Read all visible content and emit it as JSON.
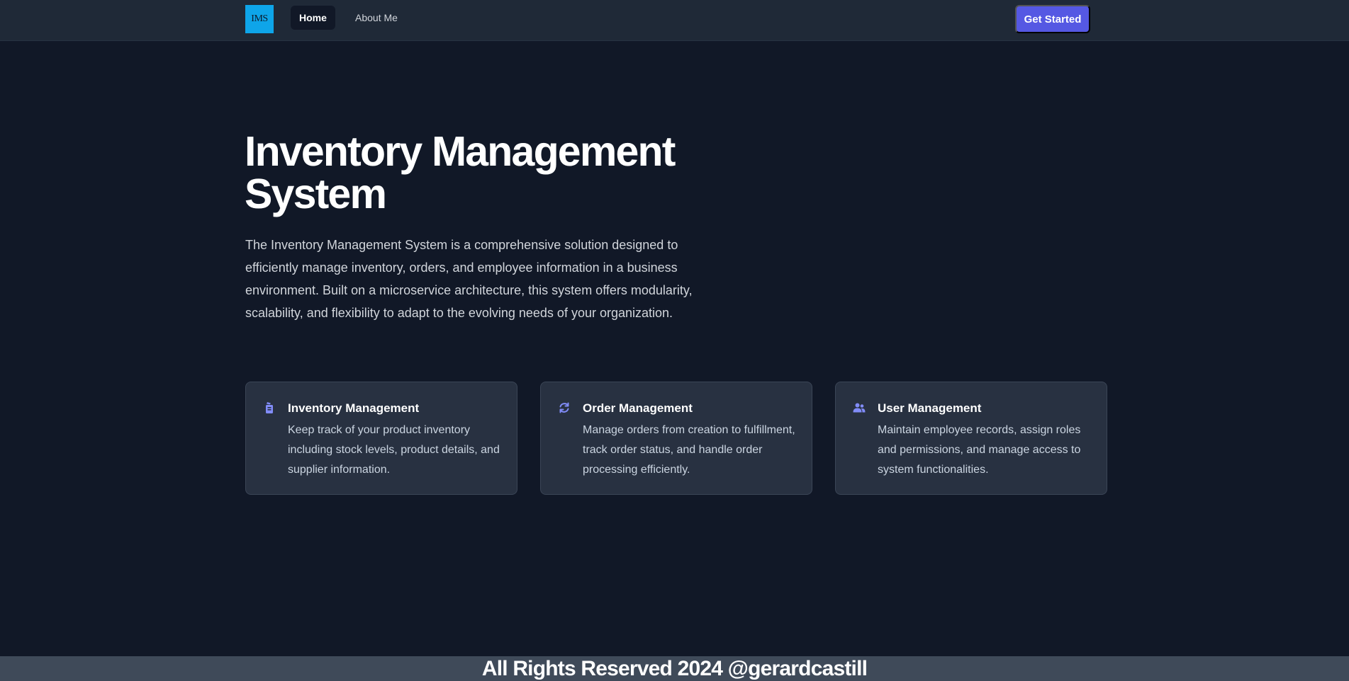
{
  "nav": {
    "logo_text": "IMS",
    "links": [
      {
        "label": "Home",
        "active": true
      },
      {
        "label": "About Me",
        "active": false
      }
    ],
    "cta_label": "Get Started"
  },
  "hero": {
    "title": "Inventory Management System",
    "description": "The Inventory Management System is a comprehensive solution designed to efficiently manage inventory, orders, and employee information in a business environment. Built on a microservice architecture, this system offers modularity, scalability, and flexibility to adapt to the evolving needs of your organization."
  },
  "features": [
    {
      "icon": "inventory-icon",
      "title": "Inventory Management",
      "text": "Keep track of your product inventory including stock levels, product details, and supplier information."
    },
    {
      "icon": "refresh-icon",
      "title": "Order Management",
      "text": "Manage orders from creation to fulfillment, track order status, and handle order processing efficiently."
    },
    {
      "icon": "users-icon",
      "title": "User Management",
      "text": "Maintain employee records, assign roles and permissions, and manage access to system functionalities."
    }
  ],
  "footer": {
    "text": "All Rights Reserved 2024 @gerardcastill"
  },
  "colors": {
    "background": "#111827",
    "navbar": "#1f2937",
    "accent": "#5558e3",
    "icon": "#818cf8",
    "logo": "#0ea5e9",
    "card": "#283141",
    "footer": "#3f4a59"
  }
}
